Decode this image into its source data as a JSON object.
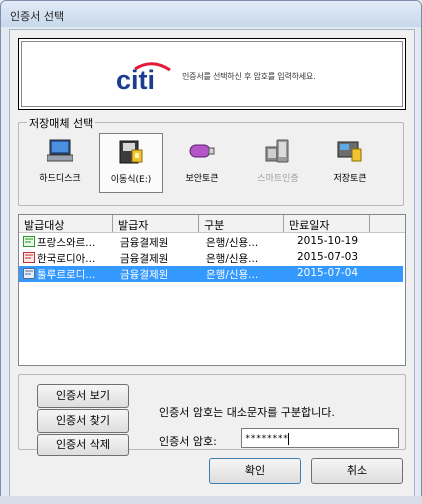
{
  "window": {
    "title": "인증서 선택"
  },
  "banner": {
    "logo_text": "citi",
    "message": "인증서를 선택하신 후 암호를 입력하세요."
  },
  "storage": {
    "label": "저장매체 선택",
    "items": [
      {
        "label": "하드디스크",
        "icon": "hard-disk-icon"
      },
      {
        "label": "이동식(E:)",
        "icon": "removable-disk-icon",
        "selected": true
      },
      {
        "label": "보안토큰",
        "icon": "security-token-icon"
      },
      {
        "label": "스마트인증",
        "icon": "smartphone-icon",
        "disabled": true
      },
      {
        "label": "저장토큰",
        "icon": "save-token-icon"
      }
    ]
  },
  "cert_list": {
    "columns": [
      "발급대상",
      "발급자",
      "구분",
      "만료일자"
    ],
    "rows": [
      {
        "subject": "프랑스와르...",
        "issuer": "금융결제원",
        "type": "은행/신용...",
        "expiry": "2015-10-19",
        "selected": false
      },
      {
        "subject": "한국로디아...",
        "issuer": "금융결제원",
        "type": "은행/신용...",
        "expiry": "2015-07-03",
        "selected": false
      },
      {
        "subject": "툴루르로디...",
        "issuer": "금융결제원",
        "type": "은행/신용...",
        "expiry": "2015-07-04",
        "selected": true
      }
    ]
  },
  "actions": {
    "view": "인증서 보기",
    "find": "인증서 찾기",
    "delete": "인증서 삭제"
  },
  "password": {
    "hint": "인증서 암호는 대소문자를 구분합니다.",
    "label": "인증서 암호:",
    "value": "********"
  },
  "buttons": {
    "ok": "확인",
    "cancel": "취소"
  },
  "colors": {
    "selection": "#3399ff",
    "citi_blue": "#1b3c8f",
    "citi_red": "#e31937"
  }
}
